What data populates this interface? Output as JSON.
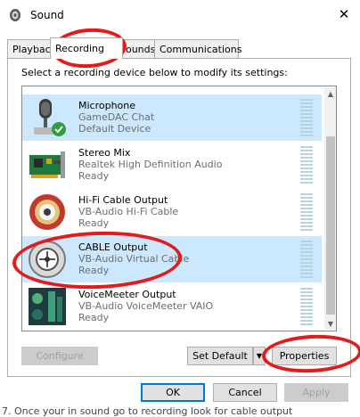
{
  "window": {
    "title": "Sound",
    "close_glyph": "✕"
  },
  "tabs": [
    {
      "label": "Playback",
      "selected": false
    },
    {
      "label": "Recording",
      "selected": true
    },
    {
      "label": "Sounds",
      "selected": false
    },
    {
      "label": "Communications",
      "selected": false
    }
  ],
  "instruction": "Select a recording device below to modify its settings:",
  "devices": [
    {
      "name": "Microphone",
      "description": "GameDAC Chat",
      "status": "Default Device",
      "icon": "microphone-icon",
      "selected": true
    },
    {
      "name": "Stereo Mix",
      "description": "Realtek High Definition Audio",
      "status": "Ready",
      "icon": "sound-card-icon",
      "selected": false
    },
    {
      "name": "Hi-Fi Cable Output",
      "description": "VB-Audio Hi-Fi Cable",
      "status": "Ready",
      "icon": "rca-jack-icon",
      "selected": false
    },
    {
      "name": "CABLE Output",
      "description": "VB-Audio Virtual Cable",
      "status": "Ready",
      "icon": "cable-connector-icon",
      "selected": true
    },
    {
      "name": "VoiceMeeter Output",
      "description": "VB-Audio VoiceMeeter VAIO",
      "status": "Ready",
      "icon": "voicemeeter-icon",
      "selected": false
    }
  ],
  "buttons": {
    "configure": "Configure",
    "set_default": "Set Default",
    "set_default_arrow": "▼",
    "properties": "Properties",
    "ok": "OK",
    "cancel": "Cancel",
    "apply": "Apply"
  },
  "scroll": {
    "up": "▲",
    "down": "▼"
  },
  "background_text": "7.    Once your in sound go to recording look for cable output",
  "colors": {
    "selection": "#cce8ff",
    "annotation_red": "#e31b1b",
    "accent": "#0078d7"
  }
}
